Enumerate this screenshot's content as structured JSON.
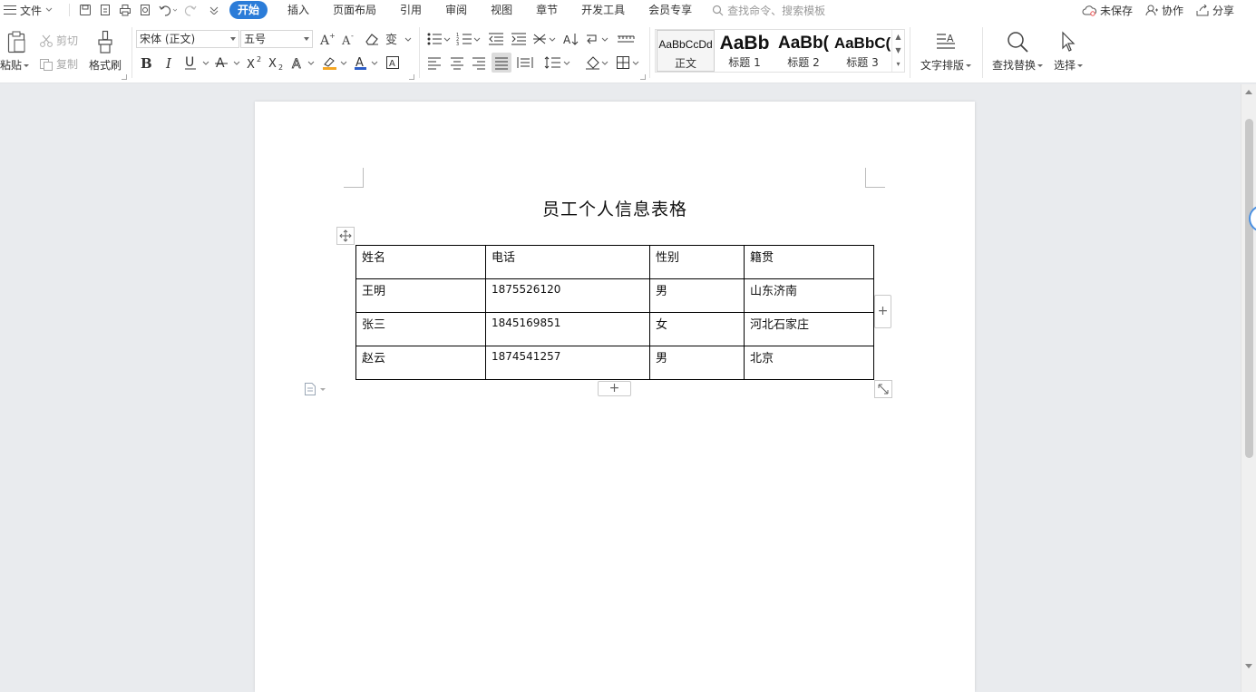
{
  "menu": {
    "file_label": "文件",
    "tabs": [
      "开始",
      "插入",
      "页面布局",
      "引用",
      "审阅",
      "视图",
      "章节",
      "开发工具",
      "会员专享"
    ],
    "search_placeholder": "查找命令、搜索模板",
    "unsaved_label": "未保存",
    "collab_label": "协作",
    "share_label": "分享"
  },
  "ribbon": {
    "paste_label": "粘贴",
    "cut_label": "剪切",
    "copy_label": "复制",
    "format_painter_label": "格式刷",
    "font_name": "宋体 (正文)",
    "font_size": "五号",
    "styles": [
      {
        "preview": "AaBbCcDd",
        "name": "正文"
      },
      {
        "preview": "AaBb",
        "name": "标题 1"
      },
      {
        "preview": "AaBb(",
        "name": "标题 2"
      },
      {
        "preview": "AaBbC(",
        "name": "标题 3"
      }
    ],
    "text_layout_label": "文字排版",
    "find_replace_label": "查找替换",
    "select_label": "选择"
  },
  "document": {
    "title": "员工个人信息表格",
    "table": {
      "headers": [
        "姓名",
        "电话",
        "性别",
        "籍贯"
      ],
      "rows": [
        [
          "王明",
          "1875526120",
          "男",
          "山东济南"
        ],
        [
          "张三",
          "1845169851",
          "女",
          "河北石家庄"
        ],
        [
          "赵云",
          "1874541257",
          "男",
          "北京"
        ]
      ]
    }
  },
  "colors": {
    "accent": "#2b7cd8",
    "workspace_bg": "#e9ebee"
  }
}
